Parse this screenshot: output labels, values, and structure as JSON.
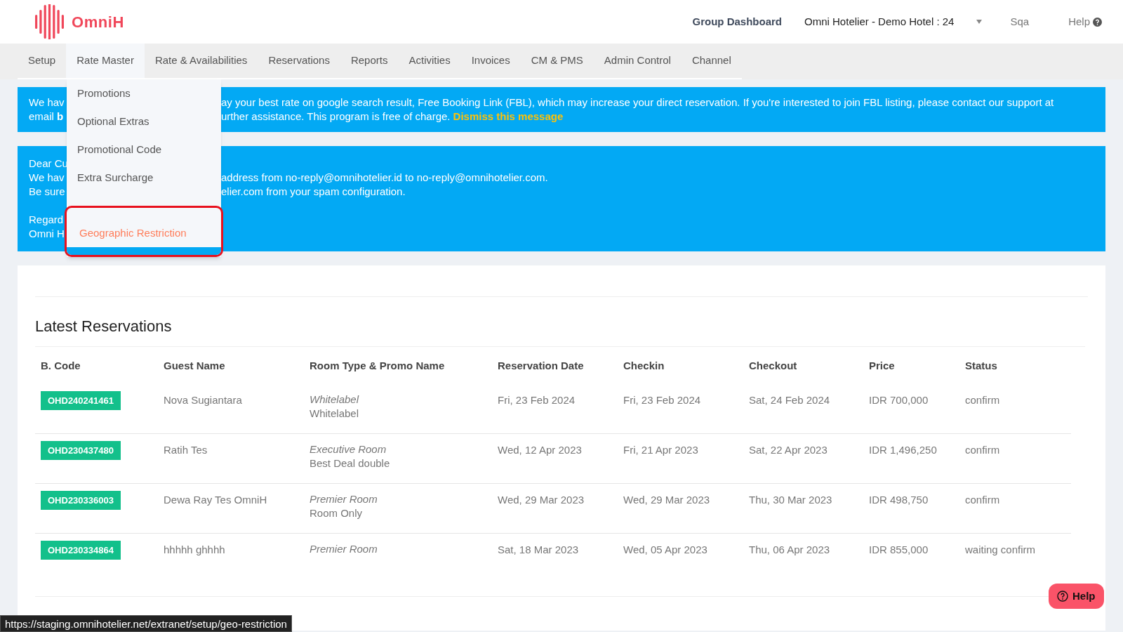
{
  "header": {
    "logo_text": "OmniH",
    "group_dashboard": "Group Dashboard",
    "hotel": "Omni Hotelier - Demo Hotel : 24",
    "user": "Sqa",
    "help": "Help"
  },
  "nav": [
    {
      "label": "Setup",
      "selected": false
    },
    {
      "label": "Rate Master",
      "selected": true
    },
    {
      "label": "Rate & Availabilities",
      "selected": false
    },
    {
      "label": "Reservations",
      "selected": false
    },
    {
      "label": "Reports",
      "selected": false
    },
    {
      "label": "Activities",
      "selected": false
    },
    {
      "label": "Invoices",
      "selected": false
    },
    {
      "label": "CM & PMS",
      "selected": false
    },
    {
      "label": "Admin Control",
      "selected": false
    },
    {
      "label": "Channel",
      "selected": false
    }
  ],
  "dropdown": [
    {
      "label": "Promotions",
      "selected": false
    },
    {
      "label": "Optional Extras",
      "selected": false
    },
    {
      "label": "Promotional Code",
      "selected": false
    },
    {
      "label": "Extra Surcharge",
      "selected": false
    },
    {
      "label": "Geographic Restriction",
      "selected": true
    }
  ],
  "banners": [
    {
      "lines": [
        {
          "left": "We hav",
          "right": "ay your best rate on google search result, Free Booking Link (FBL), which may increase your direct reservation. If you're interested to join FBL listing, please contact our support at"
        },
        {
          "left": "email **b**",
          "right": "urther assistance. This program is free of charge.",
          "link": "Dismiss this message"
        }
      ]
    },
    {
      "lines": [
        {
          "left": "Dear Cu"
        },
        {
          "left": "We hav",
          "right": "address from no-reply@omnihotelier.id to no-reply@omnihotelier.com."
        },
        {
          "left": "Be sure",
          "right": "elier.com from your spam configuration."
        },
        {
          "left": "Regard",
          "gap_before": true
        },
        {
          "left": "Omni H"
        }
      ]
    }
  ],
  "reservations": {
    "title": "Latest Reservations",
    "columns": [
      "B. Code",
      "Guest Name",
      "Room Type & Promo Name",
      "Reservation Date",
      "Checkin",
      "Checkout",
      "Price",
      "Status"
    ],
    "rows": [
      {
        "code": "OHD240241461",
        "guest": "Nova Sugiantara",
        "room_type": "Whitelabel",
        "promo": "Whitelabel",
        "reservation_date": "Fri, 23 Feb 2024",
        "checkin": "Fri, 23 Feb 2024",
        "checkout": "Sat, 24 Feb 2024",
        "price": "IDR 700,000",
        "status": "confirm"
      },
      {
        "code": "OHD230437480",
        "guest": "Ratih Tes",
        "room_type": "Executive Room",
        "promo": "Best Deal double",
        "reservation_date": "Wed, 12 Apr 2023",
        "checkin": "Fri, 21 Apr 2023",
        "checkout": "Sat, 22 Apr 2023",
        "price": "IDR 1,496,250",
        "status": "confirm"
      },
      {
        "code": "OHD230336003",
        "guest": "Dewa Ray Tes OmniH",
        "room_type": "Premier Room",
        "promo": "Room Only",
        "reservation_date": "Wed, 29 Mar 2023",
        "checkin": "Wed, 29 Mar 2023",
        "checkout": "Thu, 30 Mar 2023",
        "price": "IDR 498,750",
        "status": "confirm"
      },
      {
        "code": "OHD230334864",
        "guest": "hhhhh ghhhh",
        "room_type": "Premier Room",
        "reservation_date": "Sat, 18 Mar 2023",
        "checkin": "Wed, 05 Apr 2023",
        "checkout": "Thu, 06 Apr 2023",
        "price": "IDR 855,000",
        "status": "waiting confirm"
      }
    ]
  },
  "help_button": "Help",
  "status_url": "https://staging.omnihotelier.net/extranet/setup/geo-restriction"
}
